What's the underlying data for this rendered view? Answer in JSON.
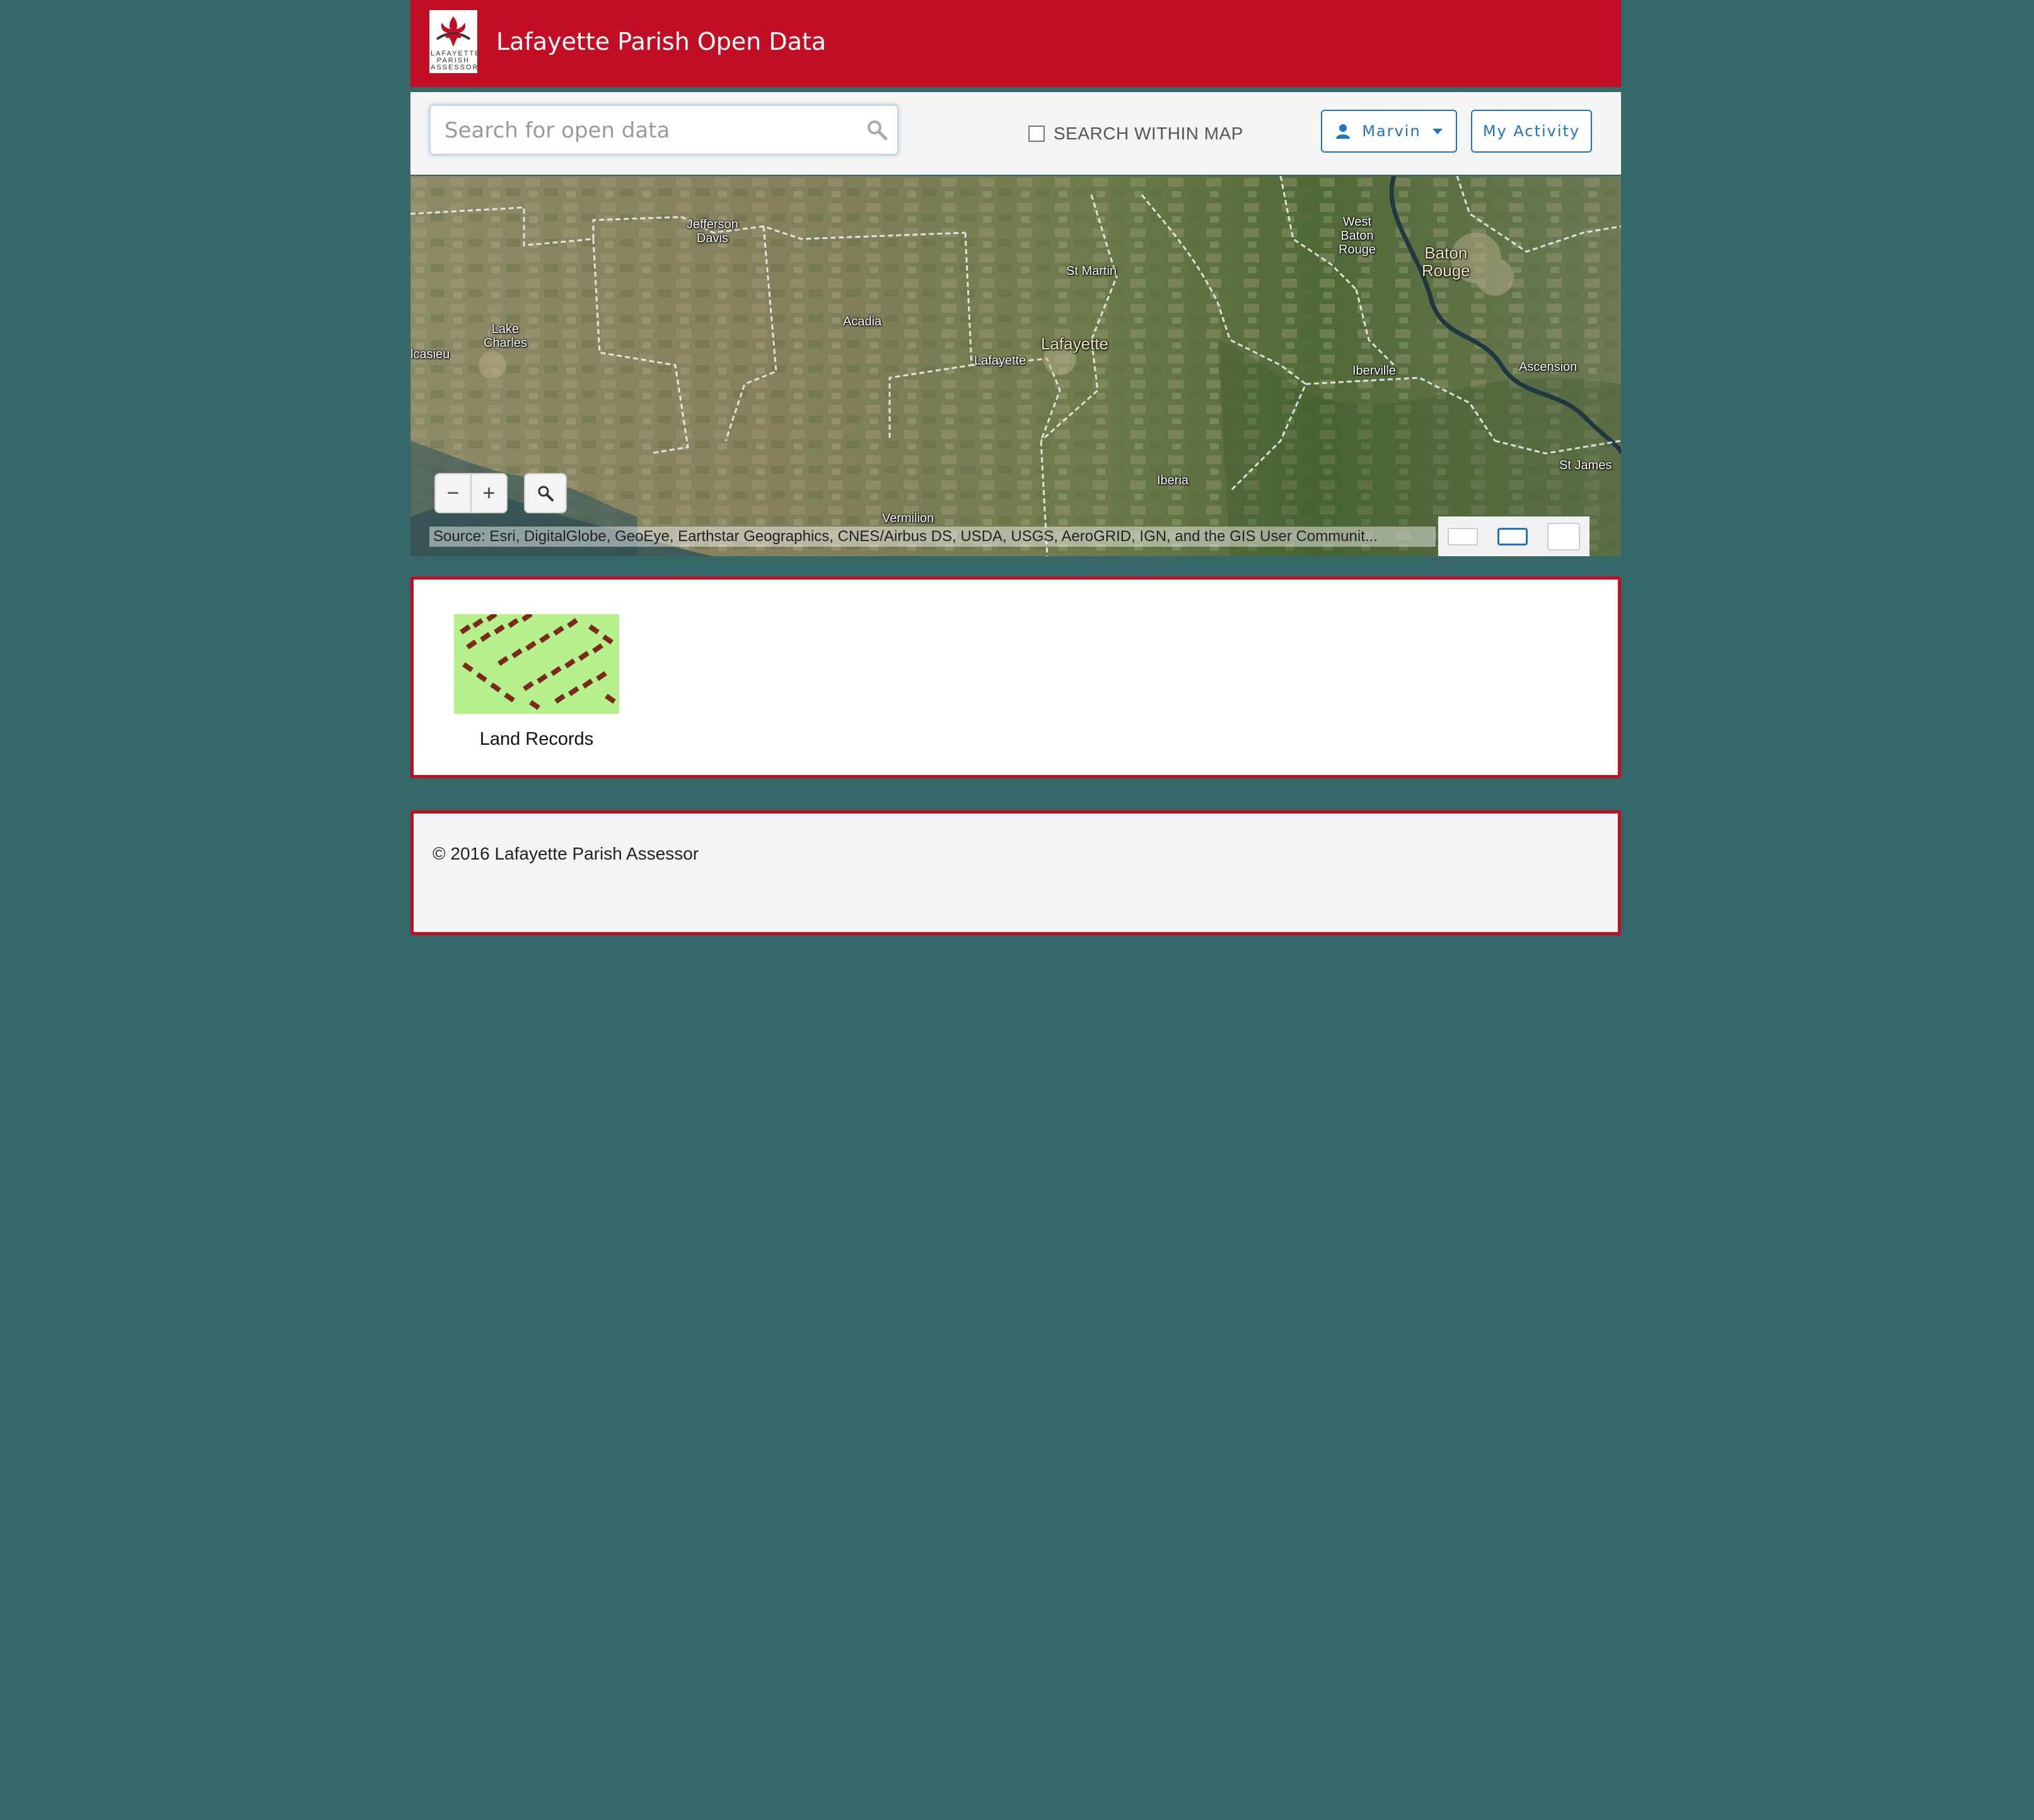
{
  "header": {
    "title": "Lafayette Parish Open Data",
    "logo_text": [
      "LAFAYETTE",
      "PARISH",
      "ASSESSOR"
    ]
  },
  "toolbar": {
    "search_placeholder": "Search for open data",
    "search_within_map_label": "SEARCH WITHIN MAP",
    "search_within_map_checked": false,
    "user_button_label": "Marvin",
    "activity_button_label": "My Activity"
  },
  "map": {
    "places": [
      {
        "name": "Jefferson\nDavis"
      },
      {
        "name": "St Martin"
      },
      {
        "name": "West\nBaton\nRouge"
      },
      {
        "name": "Baton\nRouge"
      },
      {
        "name": "Lake\nCharles"
      },
      {
        "name": "Acadia"
      },
      {
        "name": "Lafayette"
      },
      {
        "name": "Lafayette"
      },
      {
        "name": "Iberville"
      },
      {
        "name": "Ascension"
      },
      {
        "name": "lcasieu"
      },
      {
        "name": "St James"
      },
      {
        "name": "Iberia"
      },
      {
        "name": "Vermilion"
      }
    ],
    "zoom_out": "−",
    "zoom_in": "+",
    "attribution": "Source: Esri, DigitalGlobe, GeoEye, Earthstar Geographics, CNES/Airbus DS, USDA, USGS, AeroGRID, IGN, and the GIS User Communit..."
  },
  "categories": [
    {
      "label": "Land Records"
    }
  ],
  "footer": {
    "copyright": "© 2016 Lafayette Parish Assessor"
  },
  "colors": {
    "brand": "#c20e25",
    "page_background": "#36686a",
    "accent": "#1c74c2"
  }
}
